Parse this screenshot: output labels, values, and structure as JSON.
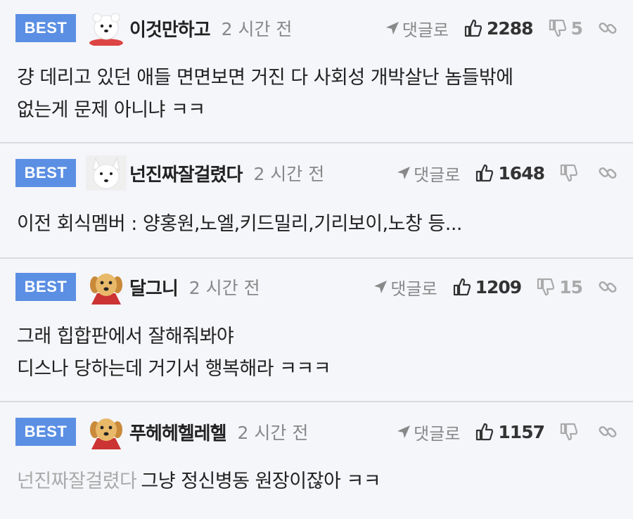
{
  "comments": [
    {
      "badge": "BEST",
      "nickname": "이것만하고",
      "time": "2 시간 전",
      "reply_label": "댓글로",
      "likes": "2288",
      "dislikes": "5",
      "avatar": "white-dog-avatar",
      "lines": [
        "걍 데리고 있던 애들 면면보면 거진 다 사회성 개박살난 놈들밖에",
        "없는게 문제 아니냐 ㅋㅋ"
      ]
    },
    {
      "badge": "BEST",
      "nickname": "넌진짜잘걸렸다",
      "time": "2 시간 전",
      "reply_label": "댓글로",
      "likes": "1648",
      "dislikes": "",
      "avatar": "white-dog-avatar",
      "lines": [
        "이전 회식멤버 : 양홍원,노엘,키드밀리,기리보이,노창 등..."
      ]
    },
    {
      "badge": "BEST",
      "nickname": "달그니",
      "time": "2 시간 전",
      "reply_label": "댓글로",
      "likes": "1209",
      "dislikes": "15",
      "avatar": "puppy-avatar",
      "lines": [
        "그래 힙합판에서 잘해줘봐야",
        "디스나 당하는데 거기서 행복해라 ㅋㅋㅋ"
      ]
    },
    {
      "badge": "BEST",
      "nickname": "푸헤헤헬레헬",
      "time": "2 시간 전",
      "reply_label": "댓글로",
      "likes": "1157",
      "dislikes": "",
      "avatar": "puppy-avatar",
      "mention": "넌진짜잘걸렸다",
      "lines": [
        "그냥 정신병동 원장이잖아 ㅋㅋ"
      ]
    }
  ],
  "colors": {
    "badge": "#5b8fe3",
    "background": "#f5f6fa",
    "divider": "#d9dbe0",
    "muted": "#888888"
  }
}
